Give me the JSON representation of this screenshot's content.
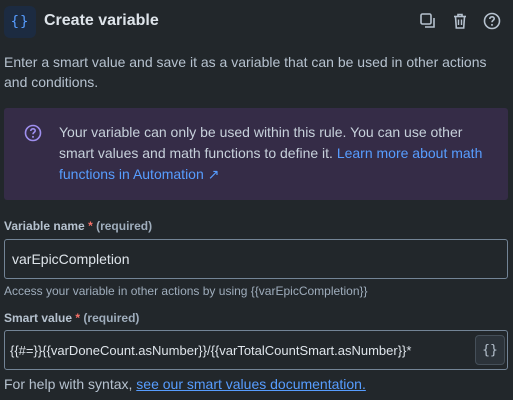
{
  "header": {
    "icon_glyph": "{}",
    "title": "Create variable",
    "actions": [
      {
        "name": "duplicate-icon"
      },
      {
        "name": "trash-icon"
      },
      {
        "name": "help-icon"
      }
    ]
  },
  "description": "Enter a smart value and save it as a variable that can be used in other actions and conditions.",
  "info": {
    "text": "Your variable can only be used within this rule. You can use other smart values and math functions to define it.",
    "link": "Learn more about math functions in Automation ↗"
  },
  "variable_name": {
    "label": "Variable name",
    "required_star": "*",
    "required_text": "(required)",
    "value": "varEpicCompletion",
    "helper": "Access your variable in other actions by using {{varEpicCompletion}}"
  },
  "smart_value": {
    "label": "Smart value",
    "required_star": "*",
    "required_text": "(required)",
    "value": "{{#=}}{{varDoneCount.asNumber}}/{{varTotalCountSmart.asNumber}}*",
    "button_glyph": "{}"
  },
  "footer": {
    "text": "For help with syntax,",
    "link": "see our smart values documentation."
  },
  "colors": {
    "background": "#22272b",
    "accent": "#579dff",
    "info_panel": "#352c47",
    "info_icon": "#9f8fef",
    "required": "#f87168"
  }
}
